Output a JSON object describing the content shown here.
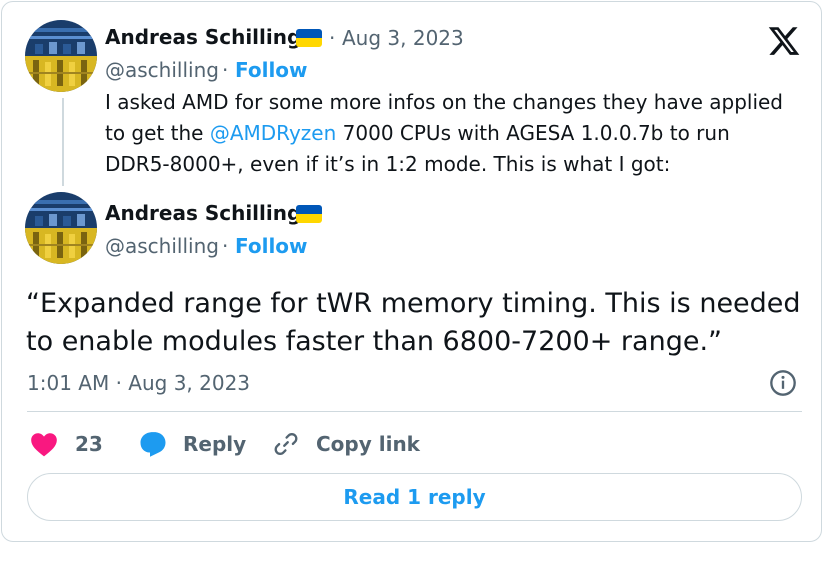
{
  "tweet_parent": {
    "author_name": "Andreas Schilling",
    "handle": "@aschilling",
    "follow_label": "Follow",
    "separator": "·",
    "date": "Aug 3, 2023",
    "text_before": "I asked AMD for some more infos on the changes they have applied to get the ",
    "mention": "@AMDRyzen",
    "text_after": " 7000 CPUs with AGESA 1.0.0.7b to run DDR5-8000+, even if it’s in 1:2 mode. This is what I got:"
  },
  "tweet_main": {
    "author_name": "Andreas Schilling",
    "handle": "@aschilling",
    "follow_label": "Follow",
    "separator": "·",
    "text": "“Expanded range for tWR memory timing. This is needed to enable modules faster than 6800-7200+ range.”",
    "timestamp": "1:01 AM · Aug 3, 2023"
  },
  "actions": {
    "like_count": "23",
    "reply_label": "Reply",
    "copy_link_label": "Copy link"
  },
  "read_replies_label": "Read 1 reply",
  "icons": {
    "brand": "x-logo-icon",
    "like": "heart-icon",
    "reply": "speech-bubble-icon",
    "copy": "link-icon",
    "info": "info-icon",
    "flag": "ukraine-flag-icon"
  },
  "colors": {
    "accent": "#1d9bf0",
    "like": "#f91880",
    "muted": "#536471",
    "text": "#0f1419",
    "border": "#cfd9de"
  }
}
